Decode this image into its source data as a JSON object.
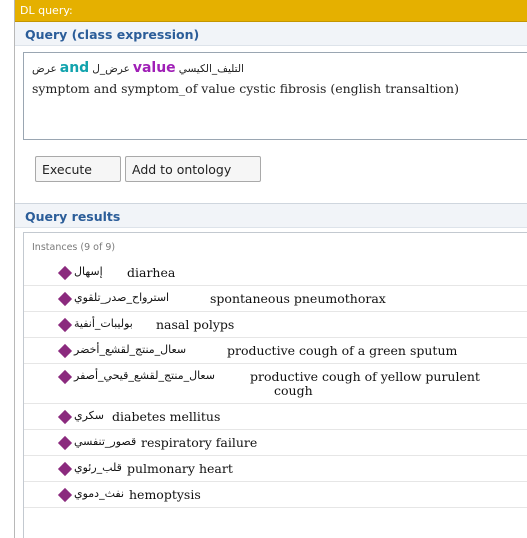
{
  "window": {
    "title": "DL query:"
  },
  "query": {
    "section_title": "Query (class expression)",
    "expression": {
      "part1": "عرض",
      "and_keyword": "and",
      "part2": "عرض_ل",
      "value_keyword": "value",
      "part3": "التليف_الكيسي"
    },
    "translation": "symptom and symptom_of value cystic fibrosis (english transaltion)",
    "buttons": {
      "execute": "Execute",
      "add_to_ontology": "Add to ontology"
    }
  },
  "results": {
    "section_title": "Query results",
    "group_header": "Instances (9 of 9)",
    "instances": [
      {
        "arabic": "إسهال",
        "english": "diarhea"
      },
      {
        "arabic": "استرواح_صدر_تلقوي",
        "english": "spontaneous pneumothorax"
      },
      {
        "arabic": "بوليبات_أنفية",
        "english": "nasal polyps"
      },
      {
        "arabic": "سعال_منتج_لقشع_أخضر",
        "english": "productive cough of a green sputum"
      },
      {
        "arabic": "سعال_منتج_لقشع_قيحي_أصفر",
        "english": "productive cough of yellow purulent",
        "english_wrap": "cough"
      },
      {
        "arabic": "سكري",
        "english": "diabetes mellitus"
      },
      {
        "arabic": "قصور_تنفسي",
        "english": "respiratory failure"
      },
      {
        "arabic": "قلب_رئوي",
        "english": "pulmonary heart"
      },
      {
        "arabic": "نفث_دموي",
        "english": "hemoptysis"
      }
    ]
  },
  "colors": {
    "titlebar": "#e5b000",
    "section_title": "#2b5d99",
    "keyword_and": "#12a3ad",
    "keyword_value": "#a01fb7",
    "individual_icon": "#8b2a7e"
  },
  "icons": {
    "individual": "diamond-icon"
  }
}
